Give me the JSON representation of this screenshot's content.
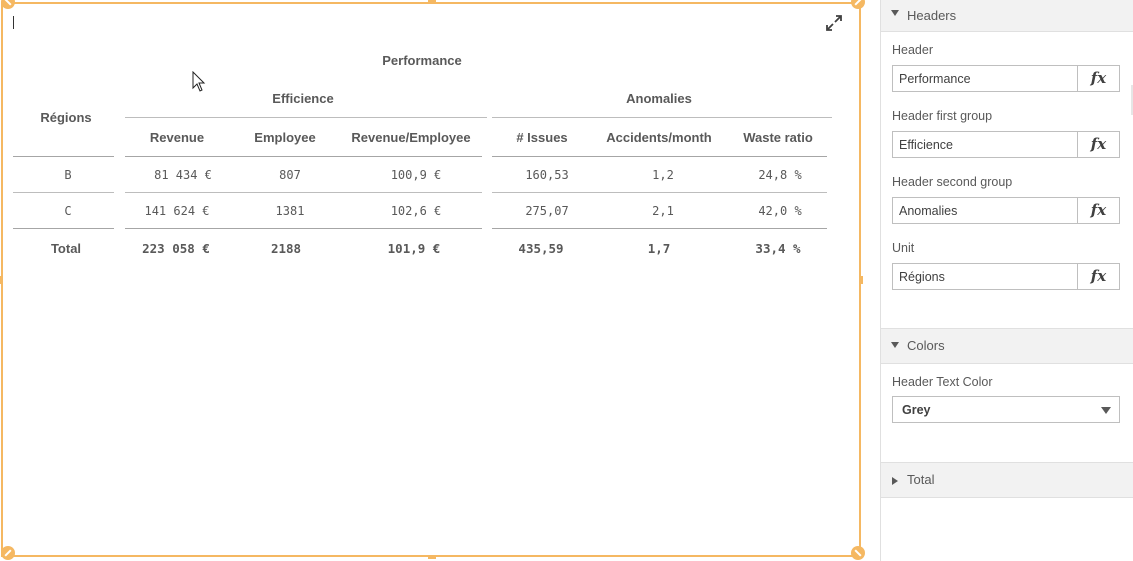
{
  "table": {
    "title": "Performance",
    "group1": "Efficience",
    "group2": "Anomalies",
    "unit_header": "Régions",
    "columns": [
      "Revenue",
      "Employee",
      "Revenue/Employee",
      "# Issues",
      "Accidents/month",
      "Waste ratio"
    ],
    "rows": [
      {
        "region": "B",
        "cells": [
          "81 434 €",
          "807",
          "100,9 €",
          "160,53",
          "1,2",
          "24,8 %"
        ]
      },
      {
        "region": "C",
        "cells": [
          "141 624 €",
          "1381",
          "102,6 €",
          "275,07",
          "2,1",
          "42,0 %"
        ]
      }
    ],
    "total": {
      "label": "Total",
      "cells": [
        "223 058 €",
        "2188",
        "101,9 €",
        "435,59",
        "1,7",
        "33,4 %"
      ]
    }
  },
  "panel": {
    "headers_section": "Headers",
    "fields": [
      {
        "label": "Header",
        "value": "Performance"
      },
      {
        "label": "Header first group",
        "value": "Efficience"
      },
      {
        "label": "Header second group",
        "value": "Anomalies"
      },
      {
        "label": "Unit",
        "value": "Régions"
      }
    ],
    "fx_label": "fx",
    "colors_section": "Colors",
    "header_text_color_label": "Header Text Color",
    "header_text_color_value": "Grey",
    "total_section": "Total"
  },
  "theme": {
    "selection_accent": "#f5b862",
    "text_grey": "#595959",
    "panel_header_bg": "#f2f2f2"
  }
}
